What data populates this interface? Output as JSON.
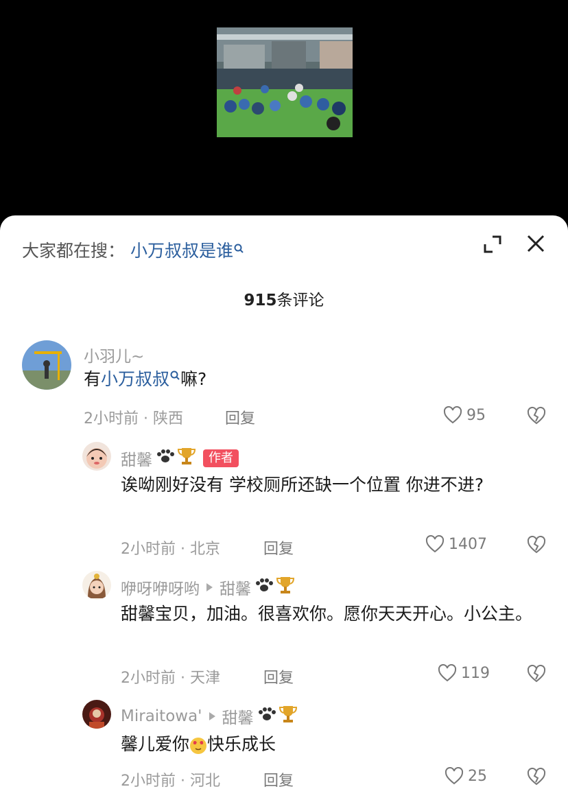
{
  "search": {
    "prefix": "大家都在搜：",
    "term": "小万叔叔是谁"
  },
  "comments_count_number": "915",
  "comments_count_suffix": "条评论",
  "comments": [
    {
      "name": "小羽儿~",
      "text_prefix": "有",
      "text_link": "小万叔叔",
      "text_suffix": "嘛?",
      "meta": "2小时前 · 陕西",
      "reply": "回复",
      "likes": "95"
    },
    {
      "name": "甜馨",
      "tag": "作者",
      "text": "诶呦刚好没有 学校厕所还缺一个位置 你进不进?",
      "meta": "2小时前 · 北京",
      "reply": "回复",
      "likes": "1407"
    },
    {
      "name": "咿呀咿呀哟",
      "reply_to": "甜馨",
      "text": "甜馨宝贝，加油。很喜欢你。愿你天天开心。小公主。",
      "meta": "2小时前 · 天津",
      "reply": "回复",
      "likes": "119"
    },
    {
      "name": "Miraitowa'",
      "reply_to": "甜馨",
      "text_prefix": "馨儿爱你",
      "text_suffix": "快乐成长",
      "meta": "2小时前 · 河北",
      "reply": "回复",
      "likes": "25"
    }
  ],
  "icons": {
    "expand": "expand-icon",
    "close": "close-icon",
    "like": "heart-icon",
    "dislike": "broken-heart-icon",
    "paw": "paw-icon",
    "trophy": "trophy-icon"
  }
}
